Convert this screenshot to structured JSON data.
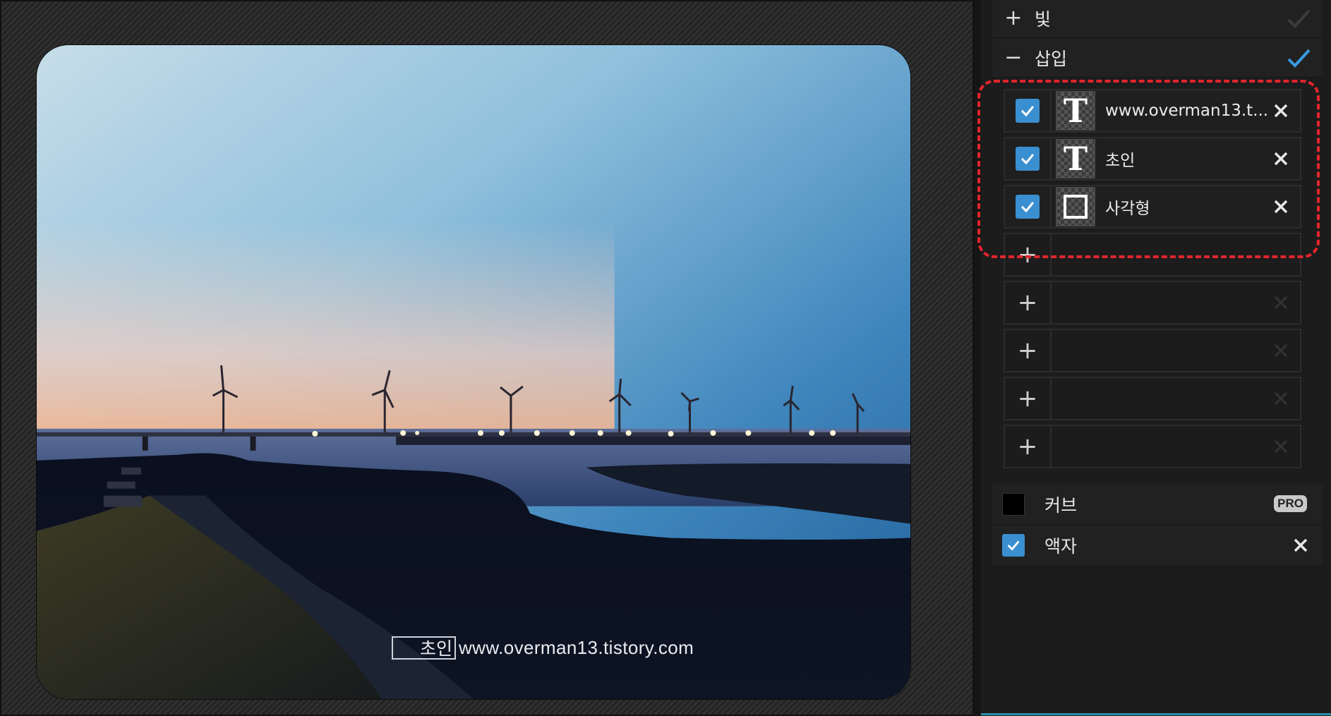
{
  "canvas": {
    "watermark_name": "초인",
    "watermark_url": "www.overman13.tistory.com"
  },
  "panel": {
    "sections": [
      {
        "sign": "+",
        "label": "빛",
        "checked": false
      },
      {
        "sign": "−",
        "label": "삽입",
        "checked": true
      }
    ],
    "layers": [
      {
        "type": "text",
        "thumb": "T",
        "name": "www.overman13.t...",
        "enabled": true
      },
      {
        "type": "text",
        "thumb": "T",
        "name": "초인",
        "enabled": true
      },
      {
        "type": "shape",
        "thumb": "rectangle",
        "name": "사각형",
        "enabled": true
      }
    ],
    "empty_slots": [
      {
        "sign": "+"
      },
      {
        "sign": "+"
      },
      {
        "sign": "+"
      },
      {
        "sign": "+"
      },
      {
        "sign": "+"
      }
    ],
    "options": [
      {
        "label": "커브",
        "checked": false,
        "badge": "PRO"
      },
      {
        "label": "액자",
        "checked": true
      }
    ]
  },
  "colors": {
    "accent": "#3a8fd0",
    "highlight": "#e4252d",
    "panel_bg": "#1c1c1c"
  },
  "icons": {
    "check": "check-icon",
    "close": "close-icon",
    "text_layer": "text-layer-icon",
    "rect_layer": "rectangle-layer-icon",
    "add": "plus-icon",
    "collapse": "minus-icon"
  }
}
